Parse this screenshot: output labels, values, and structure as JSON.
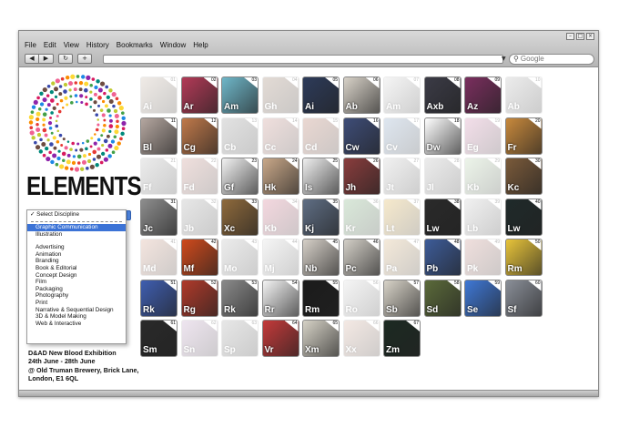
{
  "browser": {
    "menu": [
      "File",
      "Edit",
      "View",
      "History",
      "Bookmarks",
      "Window",
      "Help"
    ],
    "search_placeholder": "Google",
    "back_glyph": "◀",
    "forward_glyph": "▶",
    "reload_glyph": "↻",
    "add_glyph": "+",
    "window_buttons": [
      "–",
      "□",
      "×"
    ]
  },
  "brand": {
    "title": "ELEMENTS"
  },
  "discipline_select": {
    "header": "✓ Select Discipline",
    "options": [
      "Graphic Communication",
      "Illustration",
      "",
      "Advertising",
      "Animation",
      "Branding",
      "Book & Editorial",
      "Concept Design",
      "Film",
      "Packaging",
      "Photography",
      "Print",
      "Narrative & Sequential Design",
      "3D & Model Making",
      "Web & Interactive"
    ],
    "selected_index": 0
  },
  "exhibition": {
    "lines": [
      "D&AD New Blood Exhibition",
      "24th June - 28th June",
      "@ Old Truman Brewery, Brick Lane,",
      "London, E1 6QL"
    ]
  },
  "tiles": [
    {
      "sym": "Ai",
      "num": "01",
      "active": false,
      "color": "#c9b8a8"
    },
    {
      "sym": "Ar",
      "num": "02",
      "active": true,
      "color": "#b33a57"
    },
    {
      "sym": "Am",
      "num": "03",
      "active": true,
      "color": "#6fb7c9"
    },
    {
      "sym": "Gh",
      "num": "04",
      "active": false,
      "color": "#9c7f6a"
    },
    {
      "sym": "Ai",
      "num": "05",
      "active": true,
      "color": "#2d3b5a"
    },
    {
      "sym": "Ab",
      "num": "06",
      "active": true,
      "color": "#d8d2c8"
    },
    {
      "sym": "Am",
      "num": "07",
      "active": false,
      "color": "#ddd"
    },
    {
      "sym": "Axb",
      "num": "08",
      "active": true,
      "color": "#3b3b46"
    },
    {
      "sym": "Az",
      "num": "09",
      "active": true,
      "color": "#7a2e5e"
    },
    {
      "sym": "Ab",
      "num": "10",
      "active": false,
      "color": "#bbb"
    },
    {
      "sym": "Bl",
      "num": "11",
      "active": true,
      "color": "#b5a7a0"
    },
    {
      "sym": "Cg",
      "num": "12",
      "active": true,
      "color": "#c0794a"
    },
    {
      "sym": "Cb",
      "num": "13",
      "active": false,
      "color": "#999"
    },
    {
      "sym": "Cc",
      "num": "14",
      "active": false,
      "color": "#c98e86"
    },
    {
      "sym": "Cd",
      "num": "15",
      "active": false,
      "color": "#b6745f"
    },
    {
      "sym": "Cw",
      "num": "16",
      "active": true,
      "color": "#3e4d78"
    },
    {
      "sym": "Cv",
      "num": "17",
      "active": false,
      "color": "#8aa7c9"
    },
    {
      "sym": "Dw",
      "num": "18",
      "active": true,
      "color": "#ffffff"
    },
    {
      "sym": "Eg",
      "num": "19",
      "active": false,
      "color": "#d58ab2"
    },
    {
      "sym": "Fr",
      "num": "20",
      "active": true,
      "color": "#c8893c"
    },
    {
      "sym": "Ff",
      "num": "21",
      "active": false,
      "color": "#bbb"
    },
    {
      "sym": "Fd",
      "num": "22",
      "active": false,
      "color": "#c98e86"
    },
    {
      "sym": "Gf",
      "num": "23",
      "active": true,
      "color": "#f2f2f2"
    },
    {
      "sym": "Hk",
      "num": "24",
      "active": true,
      "color": "#c9a889"
    },
    {
      "sym": "Is",
      "num": "25",
      "active": true,
      "color": "#efefef"
    },
    {
      "sym": "Jh",
      "num": "26",
      "active": true,
      "color": "#8a3d3d"
    },
    {
      "sym": "Jt",
      "num": "27",
      "active": false,
      "color": "#ccc"
    },
    {
      "sym": "Jl",
      "num": "28",
      "active": false,
      "color": "#bbb"
    },
    {
      "sym": "Kb",
      "num": "29",
      "active": false,
      "color": "#bcd9b2"
    },
    {
      "sym": "Kc",
      "num": "30",
      "active": true,
      "color": "#7a5a3a"
    },
    {
      "sym": "Jc",
      "num": "31",
      "active": true,
      "color": "#8e8e8e"
    },
    {
      "sym": "Jb",
      "num": "32",
      "active": false,
      "color": "#aaa"
    },
    {
      "sym": "Xc",
      "num": "33",
      "active": true,
      "color": "#8f6a3c"
    },
    {
      "sym": "Kb",
      "num": "34",
      "active": false,
      "color": "#d7728c"
    },
    {
      "sym": "Kj",
      "num": "35",
      "active": true,
      "color": "#5f6e84"
    },
    {
      "sym": "Kr",
      "num": "36",
      "active": false,
      "color": "#7ab07a"
    },
    {
      "sym": "Lt",
      "num": "37",
      "active": false,
      "color": "#e0b24a"
    },
    {
      "sym": "Lw",
      "num": "38",
      "active": true,
      "color": "#2a2a2a"
    },
    {
      "sym": "Lb",
      "num": "39",
      "active": false,
      "color": "#ccc"
    },
    {
      "sym": "Lw",
      "num": "40",
      "active": true,
      "color": "#1f2a2a"
    },
    {
      "sym": "Md",
      "num": "41",
      "active": false,
      "color": "#d7a28c"
    },
    {
      "sym": "Mf",
      "num": "42",
      "active": true,
      "color": "#d04a1c"
    },
    {
      "sym": "Mo",
      "num": "43",
      "active": false,
      "color": "#bbb"
    },
    {
      "sym": "Mj",
      "num": "44",
      "active": false,
      "color": "#ddd"
    },
    {
      "sym": "Nb",
      "num": "45",
      "active": true,
      "color": "#d6d0c8"
    },
    {
      "sym": "Pc",
      "num": "46",
      "active": true,
      "color": "#d3cfc7"
    },
    {
      "sym": "Pa",
      "num": "47",
      "active": false,
      "color": "#d9b37a"
    },
    {
      "sym": "Pb",
      "num": "48",
      "active": true,
      "color": "#3d5c99"
    },
    {
      "sym": "Pk",
      "num": "49",
      "active": false,
      "color": "#c98e86"
    },
    {
      "sym": "Rm",
      "num": "50",
      "active": true,
      "color": "#e8c43a"
    },
    {
      "sym": "Rk",
      "num": "51",
      "active": true,
      "color": "#3f5eb0"
    },
    {
      "sym": "Rg",
      "num": "52",
      "active": true,
      "color": "#b03a2a"
    },
    {
      "sym": "Rk",
      "num": "53",
      "active": true,
      "color": "#8a8a8a"
    },
    {
      "sym": "Rr",
      "num": "54",
      "active": true,
      "color": "#f4f4f4"
    },
    {
      "sym": "Rm",
      "num": "55",
      "active": true,
      "color": "#1b1b1b"
    },
    {
      "sym": "Ro",
      "num": "56",
      "active": false,
      "color": "#ddd"
    },
    {
      "sym": "Sb",
      "num": "57",
      "active": true,
      "color": "#d8d3c8"
    },
    {
      "sym": "Sd",
      "num": "58",
      "active": true,
      "color": "#5b6a3a"
    },
    {
      "sym": "Se",
      "num": "59",
      "active": true,
      "color": "#3f78d6"
    },
    {
      "sym": "Sf",
      "num": "60",
      "active": true,
      "color": "#8a8f98"
    },
    {
      "sym": "Sm",
      "num": "61",
      "active": true,
      "color": "#2a2a2a"
    },
    {
      "sym": "Sn",
      "num": "62",
      "active": false,
      "color": "#c4a3c9"
    },
    {
      "sym": "Sp",
      "num": "63",
      "active": false,
      "color": "#aaa"
    },
    {
      "sym": "Vr",
      "num": "64",
      "active": true,
      "color": "#c43a3a"
    },
    {
      "sym": "Xm",
      "num": "65",
      "active": true,
      "color": "#d6d2c6"
    },
    {
      "sym": "Xx",
      "num": "66",
      "active": false,
      "color": "#d9b2a0"
    },
    {
      "sym": "Zm",
      "num": "67",
      "active": true,
      "color": "#1c2a22"
    }
  ]
}
